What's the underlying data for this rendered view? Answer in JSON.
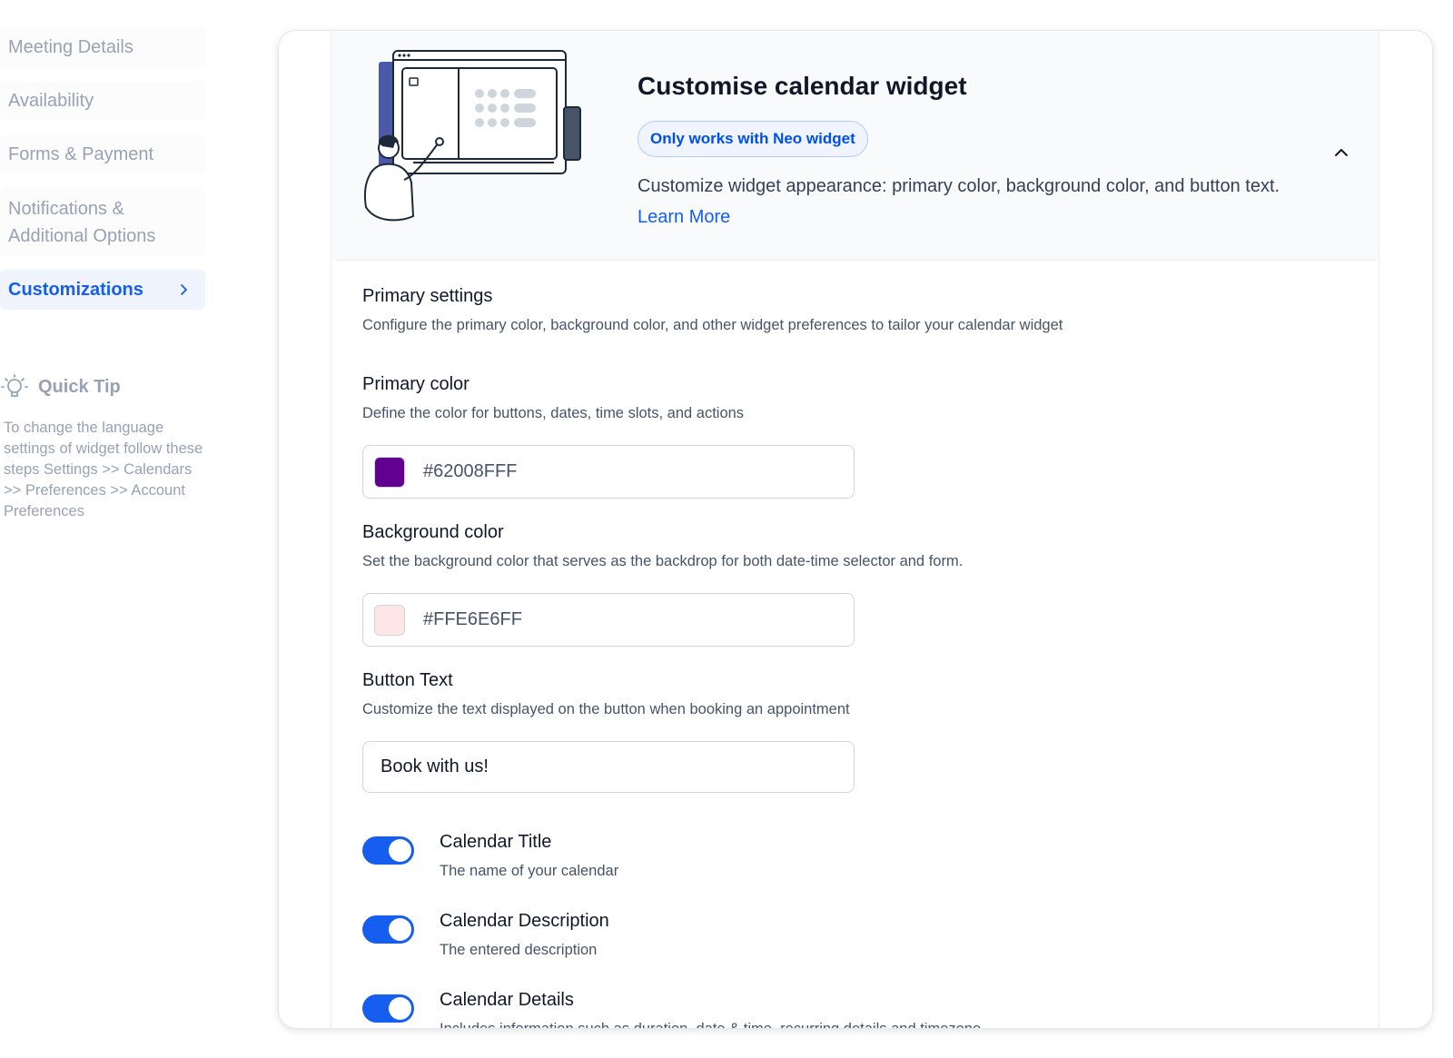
{
  "sidebar": {
    "items": [
      {
        "label": "Meeting Details"
      },
      {
        "label": "Availability"
      },
      {
        "label": "Forms & Payment"
      },
      {
        "label": "Notifications & Additional Options"
      },
      {
        "label": "Customizations",
        "active": true
      }
    ]
  },
  "tip": {
    "title": "Quick Tip",
    "body": "To change the language settings of widget follow these steps Settings >> Calendars >> Preferences >> Account Preferences"
  },
  "hero": {
    "title": "Customise calendar widget",
    "badge": "Only works with Neo widget",
    "description": "Customize widget appearance: primary color, background color, and button text.",
    "learn_more": "Learn More"
  },
  "primary_settings": {
    "title": "Primary settings",
    "subtitle": "Configure the primary color, background color, and other widget preferences to tailor your calendar widget"
  },
  "primary_color": {
    "label": "Primary color",
    "help": "Define the color for buttons, dates, time slots, and actions",
    "value": "#62008FFF",
    "swatch": "#62008F"
  },
  "background_color": {
    "label": "Background color",
    "help": "Set the background color that serves as the backdrop for both date-time selector and form.",
    "value": "#FFE6E6FF",
    "swatch": "#FFE6E6"
  },
  "button_text": {
    "label": "Button Text",
    "help": "Customize the text displayed on the button when booking an appointment",
    "value": "Book with us!"
  },
  "toggles": [
    {
      "title": "Calendar Title",
      "subtitle": "The name of your calendar",
      "on": true
    },
    {
      "title": "Calendar Description",
      "subtitle": "The entered description",
      "on": true
    },
    {
      "title": "Calendar Details",
      "subtitle": "Includes information such as duration, date & time, recurring details and timezone",
      "on": true
    }
  ],
  "colors": {
    "accent": "#155EEF",
    "badge_bg": "#EFF4FF",
    "muted": "#98A2B3"
  }
}
